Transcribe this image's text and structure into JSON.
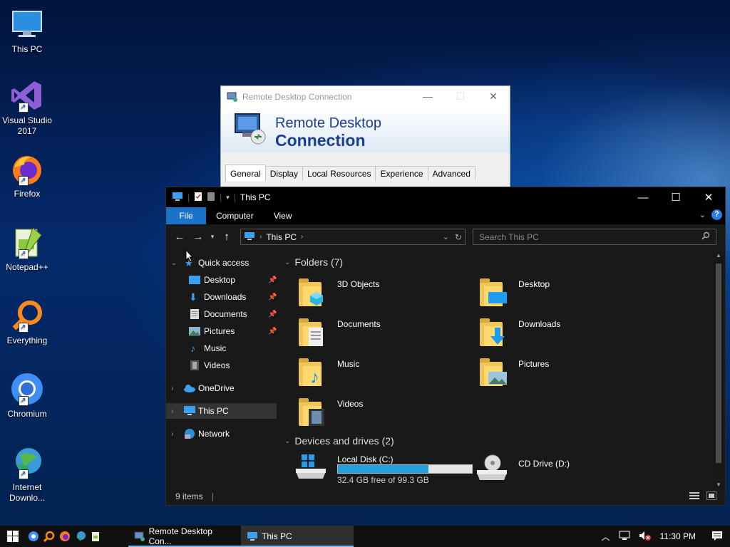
{
  "desktop": {
    "icons": [
      {
        "label": "This PC"
      },
      {
        "label": "Visual Studio 2017"
      },
      {
        "label": "Firefox"
      },
      {
        "label": "Notepad++"
      },
      {
        "label": "Everything"
      },
      {
        "label": "Chromium"
      },
      {
        "label": "Internet Downlo..."
      }
    ]
  },
  "rdc": {
    "title": "Remote Desktop Connection",
    "banner_line1": "Remote Desktop",
    "banner_line2": "Connection",
    "tabs": [
      "General",
      "Display",
      "Local Resources",
      "Experience",
      "Advanced"
    ],
    "active_tab": "General"
  },
  "explorer": {
    "title": "This PC",
    "ribbon_tabs": [
      "File",
      "Computer",
      "View"
    ],
    "address_crumb": "This PC",
    "search_placeholder": "Search This PC",
    "sidebar": {
      "quick_access": "Quick access",
      "quick_items": [
        "Desktop",
        "Downloads",
        "Documents",
        "Pictures",
        "Music",
        "Videos"
      ],
      "onedrive": "OneDrive",
      "this_pc": "This PC",
      "network": "Network"
    },
    "folders_header": "Folders (7)",
    "folders": [
      "3D Objects",
      "Desktop",
      "Documents",
      "Downloads",
      "Music",
      "Pictures",
      "Videos"
    ],
    "drives_header": "Devices and drives (2)",
    "drives": [
      {
        "name": "Local Disk (C:)",
        "free": "32.4 GB free of 99.3 GB",
        "used_fraction": 0.674
      },
      {
        "name": "CD Drive (D:)"
      }
    ],
    "status": "9 items"
  },
  "taskbar": {
    "apps": [
      "Remote Desktop Con...",
      "This PC"
    ],
    "clock": "11:30 PM"
  },
  "colors": {
    "accent": "#1a73c8",
    "drive_fill": "#26a0da",
    "explorer_bg": "#191919"
  }
}
